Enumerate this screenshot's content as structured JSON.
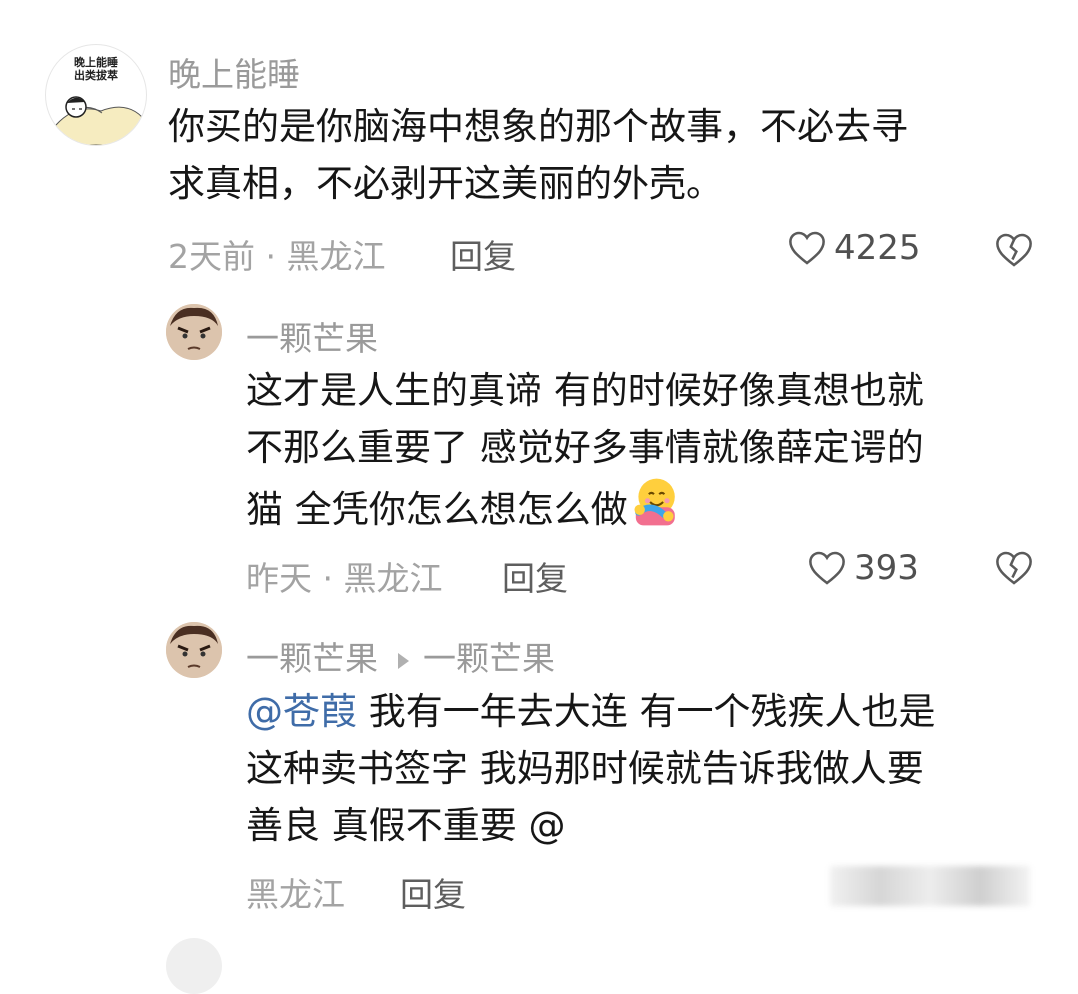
{
  "comments": [
    {
      "username": "晚上能睡",
      "avatar_text": [
        "晚上能睡",
        "出类拔萃"
      ],
      "content_lines": [
        "你买的是你脑海中想象的那个故事，不必去寻",
        "求真相，不必剥开这美丽的外壳。"
      ],
      "meta": "2天前 · 黑龙江",
      "reply_label": "回复",
      "likes": "4225"
    },
    {
      "username": "一颗芒果",
      "content_lines": [
        "这才是人生的真谛 有的时候好像真想也就",
        "不那么重要了 感觉好多事情就像薛定谔的",
        "猫 全凭你怎么想怎么做"
      ],
      "meta": "昨天 · 黑龙江",
      "reply_label": "回复",
      "likes": "393"
    },
    {
      "username": "一颗芒果",
      "reply_to": "一颗芒果",
      "mention": "@苍葭",
      "content_lines": [
        " 我有一年去大连 有一个残疾人也是",
        "这种卖书签字 我妈那时候就告诉我做人要",
        "善良 真假不重要 @"
      ],
      "meta": "黑龙江",
      "reply_label": "回复"
    }
  ],
  "colors": {
    "mention": "#3f6ca8",
    "text": "#161616",
    "muted": "#9a9a9a"
  },
  "icons": [
    "heart-outline-icon",
    "broken-heart-icon",
    "hug-emoji-icon"
  ]
}
